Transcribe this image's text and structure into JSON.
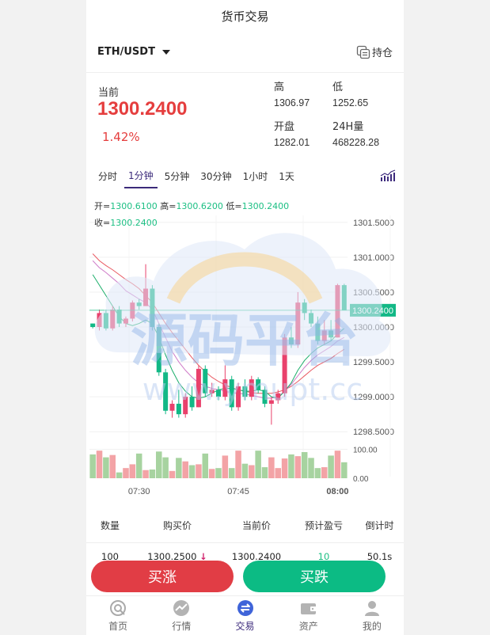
{
  "header": {
    "title": "货币交易"
  },
  "pair": {
    "name": "ETH/USDT",
    "hold_label": "持仓"
  },
  "quote": {
    "current_label": "当前",
    "current_price": "1300.2400",
    "change_pct": "1.42%",
    "high_label": "高",
    "high": "1306.97",
    "low_label": "低",
    "low": "1252.65",
    "open_label": "开盘",
    "open": "1282.01",
    "vol_label": "24H量",
    "vol": "468228.28"
  },
  "tabs": [
    {
      "label": "分时"
    },
    {
      "label": "1分钟"
    },
    {
      "label": "5分钟"
    },
    {
      "label": "30分钟"
    },
    {
      "label": "1小时"
    },
    {
      "label": "1天"
    }
  ],
  "ohlc": {
    "open_label": "开=",
    "open": "1300.6100",
    "high_label": "高=",
    "high": "1300.6200",
    "low_label": "低=",
    "low": "1300.2400",
    "close_label": "收=",
    "close": "1300.2400"
  },
  "watermark": {
    "text1": "源码平台",
    "text2": "www.ymupt.cc"
  },
  "chart_data": {
    "type": "candlestick",
    "y_ticks": [
      "1301.5000",
      "1301.0000",
      "1300.5000",
      "1300.0000",
      "1299.5000",
      "1299.0000",
      "1298.5000"
    ],
    "y_range": [
      1298.4,
      1301.6
    ],
    "current_price_label": "1300.2400",
    "current_price": 1300.24,
    "volume_ticks": [
      "100.00",
      "0.00"
    ],
    "volume_range": [
      0,
      120
    ],
    "x_ticks": [
      {
        "label": "07:30",
        "index": 7
      },
      {
        "label": "07:45",
        "index": 22
      },
      {
        "label": "08:00",
        "index": 37,
        "bold": true
      }
    ],
    "candles": [
      {
        "o": 1300.05,
        "h": 1300.05,
        "l": 1299.98,
        "c": 1300.0
      },
      {
        "o": 1300.0,
        "h": 1300.25,
        "l": 1299.95,
        "c": 1300.2
      },
      {
        "o": 1300.2,
        "h": 1300.25,
        "l": 1299.95,
        "c": 1299.98
      },
      {
        "o": 1299.98,
        "h": 1300.3,
        "l": 1299.95,
        "c": 1300.25
      },
      {
        "o": 1300.25,
        "h": 1300.3,
        "l": 1300.0,
        "c": 1300.05
      },
      {
        "o": 1300.05,
        "h": 1300.15,
        "l": 1300.0,
        "c": 1300.12
      },
      {
        "o": 1300.12,
        "h": 1300.38,
        "l": 1300.08,
        "c": 1300.35
      },
      {
        "o": 1300.35,
        "h": 1300.4,
        "l": 1300.25,
        "c": 1300.3
      },
      {
        "o": 1300.3,
        "h": 1300.9,
        "l": 1300.3,
        "c": 1300.55
      },
      {
        "o": 1300.55,
        "h": 1300.6,
        "l": 1299.95,
        "c": 1300.0
      },
      {
        "o": 1300.0,
        "h": 1300.05,
        "l": 1299.3,
        "c": 1299.35
      },
      {
        "o": 1299.35,
        "h": 1299.4,
        "l": 1298.75,
        "c": 1298.8
      },
      {
        "o": 1298.8,
        "h": 1298.95,
        "l": 1298.7,
        "c": 1298.9
      },
      {
        "o": 1298.9,
        "h": 1299.1,
        "l": 1298.7,
        "c": 1298.75
      },
      {
        "o": 1298.75,
        "h": 1299.05,
        "l": 1298.7,
        "c": 1299.0
      },
      {
        "o": 1299.0,
        "h": 1299.15,
        "l": 1298.8,
        "c": 1298.85
      },
      {
        "o": 1298.85,
        "h": 1299.45,
        "l": 1298.85,
        "c": 1299.4
      },
      {
        "o": 1299.4,
        "h": 1299.45,
        "l": 1299.0,
        "c": 1299.05
      },
      {
        "o": 1299.05,
        "h": 1299.2,
        "l": 1299.0,
        "c": 1299.1
      },
      {
        "o": 1299.1,
        "h": 1299.15,
        "l": 1298.95,
        "c": 1299.0
      },
      {
        "o": 1299.0,
        "h": 1299.45,
        "l": 1298.95,
        "c": 1299.25
      },
      {
        "o": 1299.25,
        "h": 1299.3,
        "l": 1298.8,
        "c": 1298.85
      },
      {
        "o": 1298.85,
        "h": 1299.2,
        "l": 1298.8,
        "c": 1299.15
      },
      {
        "o": 1299.15,
        "h": 1299.25,
        "l": 1298.95,
        "c": 1299.0
      },
      {
        "o": 1299.0,
        "h": 1299.3,
        "l": 1298.95,
        "c": 1299.25
      },
      {
        "o": 1299.25,
        "h": 1299.28,
        "l": 1299.05,
        "c": 1299.1
      },
      {
        "o": 1299.1,
        "h": 1299.15,
        "l": 1298.85,
        "c": 1298.9
      },
      {
        "o": 1298.9,
        "h": 1299.0,
        "l": 1298.6,
        "c": 1298.95
      },
      {
        "o": 1298.95,
        "h": 1299.1,
        "l": 1298.9,
        "c": 1299.05
      },
      {
        "o": 1299.05,
        "h": 1299.9,
        "l": 1299.0,
        "c": 1299.85
      },
      {
        "o": 1299.85,
        "h": 1300.0,
        "l": 1299.7,
        "c": 1299.75
      },
      {
        "o": 1299.75,
        "h": 1300.5,
        "l": 1299.7,
        "c": 1300.35
      },
      {
        "o": 1300.35,
        "h": 1300.4,
        "l": 1300.1,
        "c": 1300.2
      },
      {
        "o": 1300.2,
        "h": 1300.25,
        "l": 1300.0,
        "c": 1300.05
      },
      {
        "o": 1300.05,
        "h": 1300.15,
        "l": 1299.75,
        "c": 1299.8
      },
      {
        "o": 1299.8,
        "h": 1300.1,
        "l": 1299.75,
        "c": 1299.95
      },
      {
        "o": 1299.95,
        "h": 1300.1,
        "l": 1299.8,
        "c": 1299.85
      },
      {
        "o": 1299.85,
        "h": 1300.62,
        "l": 1299.85,
        "c": 1300.6
      },
      {
        "o": 1300.6,
        "h": 1300.62,
        "l": 1300.24,
        "c": 1300.24
      }
    ],
    "volumes": [
      82,
      95,
      72,
      80,
      20,
      35,
      48,
      85,
      28,
      30,
      92,
      72,
      25,
      70,
      58,
      45,
      48,
      85,
      32,
      35,
      78,
      35,
      95,
      50,
      45,
      95,
      38,
      72,
      35,
      68,
      82,
      76,
      90,
      70,
      35,
      38,
      78,
      95,
      55
    ],
    "ma_series": [
      {
        "color": "#e95a63",
        "values": [
          1301.05,
          1300.95,
          1300.88,
          1300.82,
          1300.75,
          1300.68,
          1300.62,
          1300.55,
          1300.45,
          1300.35,
          1300.2,
          1300.05,
          1299.92,
          1299.8,
          1299.68,
          1299.56,
          1299.45,
          1299.36,
          1299.28,
          1299.22,
          1299.17,
          1299.13,
          1299.1,
          1299.08,
          1299.06,
          1299.05,
          1299.05,
          1299.05,
          1299.07,
          1299.1,
          1299.15,
          1299.22,
          1299.3,
          1299.38,
          1299.45,
          1299.5,
          1299.55,
          1299.62,
          1299.68
        ]
      },
      {
        "color": "#cf7cc8",
        "values": [
          1300.95,
          1300.85,
          1300.78,
          1300.7,
          1300.62,
          1300.52,
          1300.46,
          1300.4,
          1300.35,
          1300.25,
          1300.05,
          1299.85,
          1299.65,
          1299.5,
          1299.38,
          1299.28,
          1299.2,
          1299.15,
          1299.12,
          1299.1,
          1299.08,
          1299.06,
          1299.05,
          1299.04,
          1299.02,
          1299.0,
          1298.98,
          1298.98,
          1299.0,
          1299.08,
          1299.18,
          1299.3,
          1299.42,
          1299.52,
          1299.6,
          1299.66,
          1299.72,
          1299.8,
          1299.85
        ]
      },
      {
        "color": "#1bae6a",
        "values": [
          1300.75,
          1300.6,
          1300.45,
          1300.3,
          1300.15,
          1300.05,
          1300.02,
          1300.05,
          1300.1,
          1300.05,
          1299.85,
          1299.6,
          1299.38,
          1299.2,
          1299.08,
          1299.0,
          1298.98,
          1299.0,
          1299.05,
          1299.1,
          1299.12,
          1299.12,
          1299.1,
          1299.08,
          1299.08,
          1299.1,
          1299.08,
          1299.0,
          1298.98,
          1299.08,
          1299.2,
          1299.38,
          1299.52,
          1299.62,
          1299.7,
          1299.75,
          1299.8,
          1299.9,
          1299.98
        ]
      }
    ]
  },
  "orders": {
    "headers": [
      "数量",
      "购买价",
      "当前价",
      "预计盈亏",
      "倒计时"
    ],
    "rows": [
      {
        "qty": "100",
        "buy_price": "1300.2500",
        "current": "1300.2400",
        "pnl": "10",
        "countdown": "50.1s"
      }
    ]
  },
  "actions": {
    "buy_up": "买涨",
    "buy_down": "买跌"
  },
  "nav": [
    {
      "label": "首页"
    },
    {
      "label": "行情"
    },
    {
      "label": "交易"
    },
    {
      "label": "资产"
    },
    {
      "label": "我的"
    }
  ]
}
